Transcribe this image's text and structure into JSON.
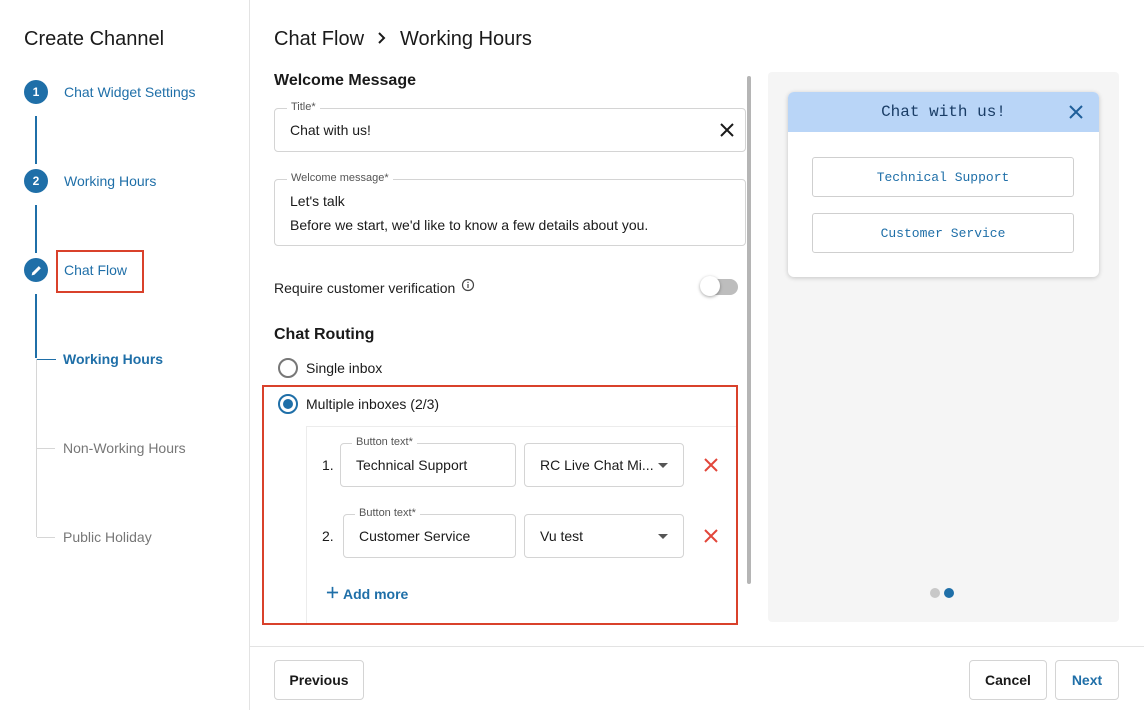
{
  "sidebar": {
    "title": "Create Channel",
    "steps": [
      {
        "number": "1",
        "label": "Chat Widget Settings"
      },
      {
        "number": "2",
        "label": "Working Hours"
      },
      {
        "number": "",
        "label": "Chat Flow",
        "icon": "pencil-icon"
      }
    ],
    "substeps": [
      {
        "label": "Working Hours",
        "state": "active"
      },
      {
        "label": "Non-Working Hours",
        "state": "inactive"
      },
      {
        "label": "Public Holiday",
        "state": "inactive"
      }
    ]
  },
  "breadcrumb": {
    "parent": "Chat Flow",
    "separator_icon": "chevron-right-icon",
    "current": "Working Hours"
  },
  "welcome": {
    "section_title": "Welcome Message",
    "title_label": "Title*",
    "title_value": "Chat with us!",
    "message_label": "Welcome message*",
    "message_line1": "Let's talk",
    "message_line2": "Before we start, we'd like to know a few details about you."
  },
  "verification": {
    "label": "Require customer verification",
    "info_icon": "info-icon",
    "enabled": false
  },
  "routing": {
    "section_title": "Chat Routing",
    "options": [
      {
        "label": "Single inbox",
        "checked": false
      },
      {
        "label": "Multiple inboxes (2/3)",
        "checked": true
      }
    ],
    "rows": [
      {
        "number": "1.",
        "button_label": "Button text*",
        "button_text": "Technical Support",
        "inbox": "RC Live Chat Mi..."
      },
      {
        "number": "2.",
        "button_label": "Button text*",
        "button_text": "Customer Service",
        "inbox": "Vu test"
      }
    ],
    "add_more": "Add more"
  },
  "preview": {
    "header_title": "Chat with us!",
    "options": [
      "Technical Support",
      "Customer Service"
    ],
    "page_count": 2,
    "active_page": 2
  },
  "footer": {
    "previous": "Previous",
    "cancel": "Cancel",
    "next": "Next"
  },
  "colors": {
    "accent": "#1f6fa8",
    "highlight": "#d9412b",
    "remove": "#e2463a",
    "preview_header": "#b9d5f7"
  }
}
